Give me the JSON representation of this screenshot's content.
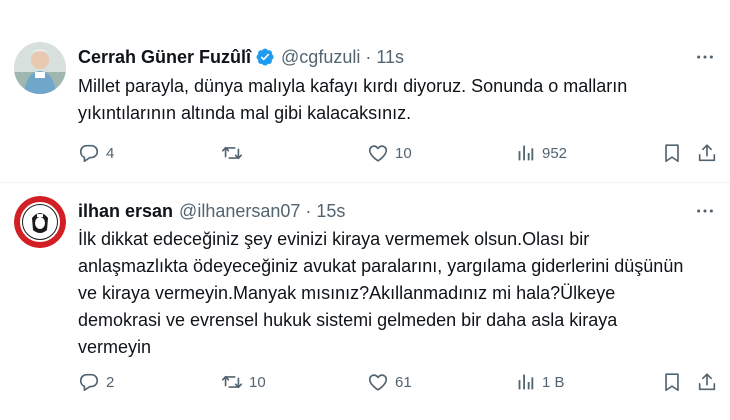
{
  "tweets": [
    {
      "name": "Cerrah Güner Fuzûlî",
      "handle": "@cgfuzuli",
      "dot": "·",
      "time": "11s",
      "verified": true,
      "text_lines": [
        "Millet parayla, dünya malıyla kafayı kırdı diyoruz. Sonunda o malların",
        "yıkıntılarının altında mal gibi kalacaksınız."
      ],
      "replies": "4",
      "retweets": "",
      "likes": "10",
      "views": "952"
    },
    {
      "name": "ilhan ersan",
      "handle": "@ilhanersan07",
      "dot": "·",
      "time": "15s",
      "verified": false,
      "text_lines": [
        "İlk dikkat edeceğiniz şey evinizi kiraya vermemek olsun.Olası bir",
        "anlaşmazlıkta ödeyeceğiniz avukat paralarını, yargılama giderlerini düşünün",
        "ve kiraya vermeyin.Manyak mısınız?Akıllanmadınız mi hala?Ülkeye",
        "demokrasi ve evrensel hukuk sistemi gelmeden bir daha asla kiraya",
        "vermeyin"
      ],
      "replies": "2",
      "retweets": "10",
      "likes": "61",
      "views": "1 B"
    }
  ],
  "colors": {
    "text": "#0f1419",
    "secondary": "#536471",
    "verified": "#1d9bf0",
    "divider": "#eff3f4",
    "badge_red": "#d21f26"
  },
  "icons": {
    "more": "more-icon",
    "reply": "reply-icon",
    "retweet": "retweet-icon",
    "like": "like-icon",
    "views": "views-icon",
    "bookmark": "bookmark-icon",
    "share": "share-icon"
  }
}
